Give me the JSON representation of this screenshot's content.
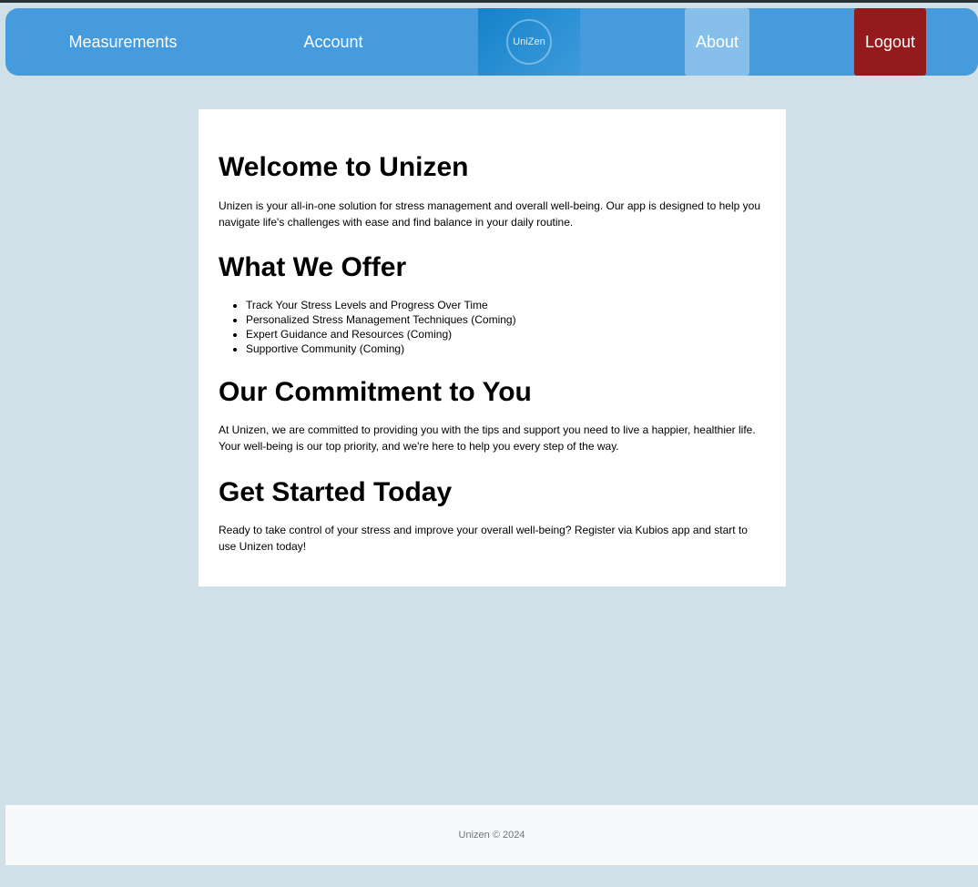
{
  "nav": {
    "measurements": "Measurements",
    "account": "Account",
    "logo_text": "UniZen",
    "about": "About",
    "logout": "Logout"
  },
  "main": {
    "welcome_title": "Welcome to Unizen",
    "welcome_text": "Unizen is your all-in-one solution for stress management and overall well-being. Our app is designed to help you navigate life's challenges with ease and find balance in your daily routine.",
    "offer_title": "What We Offer",
    "offer_items": [
      "Track Your Stress Levels and Progress Over Time",
      "Personalized Stress Management Techniques (Coming)",
      "Expert Guidance and Resources (Coming)",
      "Supportive Community (Coming)"
    ],
    "commitment_title": "Our Commitment to You",
    "commitment_text": "At Unizen, we are committed to providing you with the tips and support you need to live a happier, healthier life. Your well-being is our top priority, and we're here to help you every step of the way.",
    "start_title": "Get Started Today",
    "start_text": "Ready to take control of your stress and improve your overall well-being? Register via Kubios app and start to use Unizen today!"
  },
  "footer": {
    "copyright": "Unizen © 2024"
  },
  "colors": {
    "navbar": "#469bdc",
    "about_bg": "#86c0ea",
    "logout_bg": "#931b1b",
    "page_bg": "#cfe0e8"
  }
}
